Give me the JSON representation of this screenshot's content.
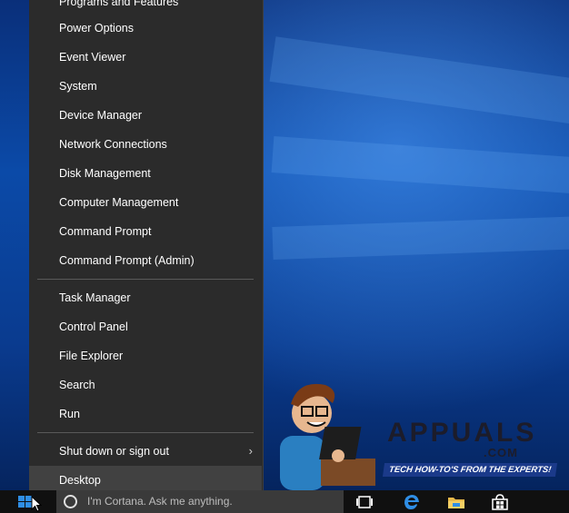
{
  "menu": {
    "items_group1": [
      {
        "label": "Programs and Features"
      },
      {
        "label": "Power Options"
      },
      {
        "label": "Event Viewer"
      },
      {
        "label": "System"
      },
      {
        "label": "Device Manager"
      },
      {
        "label": "Network Connections"
      },
      {
        "label": "Disk Management"
      },
      {
        "label": "Computer Management"
      },
      {
        "label": "Command Prompt"
      },
      {
        "label": "Command Prompt (Admin)"
      }
    ],
    "items_group2": [
      {
        "label": "Task Manager"
      },
      {
        "label": "Control Panel"
      },
      {
        "label": "File Explorer"
      },
      {
        "label": "Search"
      },
      {
        "label": "Run"
      }
    ],
    "items_group3": [
      {
        "label": "Shut down or sign out",
        "submenu_indicator": "›"
      },
      {
        "label": "Desktop"
      }
    ]
  },
  "taskbar": {
    "cortana_placeholder": "I'm Cortana. Ask me anything.",
    "icons": [
      "start-icon",
      "task-view-icon",
      "edge-icon",
      "file-explorer-icon",
      "store-icon"
    ]
  },
  "watermark": {
    "title": "APPUALS",
    "domain": ".COM",
    "tagline": "TECH HOW-TO'S FROM THE EXPERTS!"
  },
  "colors": {
    "menu_bg": "#2b2b2b",
    "menu_highlight": "#414141",
    "accent": "#2f8ee6",
    "taskbar_bg": "#101010"
  }
}
